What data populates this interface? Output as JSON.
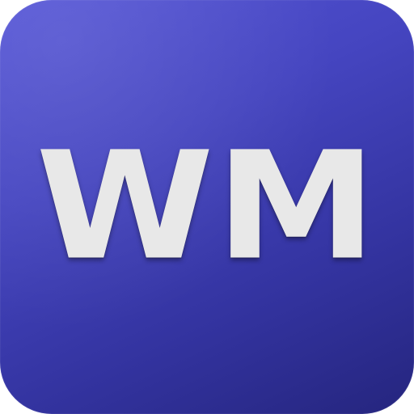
{
  "icon": {
    "text_first": "W",
    "text_second": "M",
    "colors": {
      "background_top": "#5454d6",
      "background_bottom": "#25257e",
      "letter": "#e8e8e8"
    }
  }
}
